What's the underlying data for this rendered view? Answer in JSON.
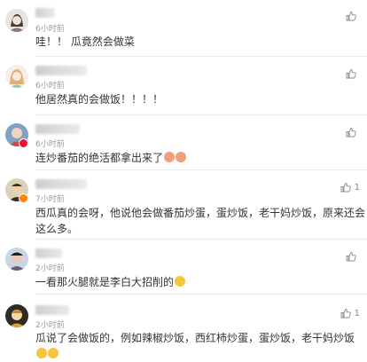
{
  "comments": [
    {
      "time": "6小时前",
      "text": "哇！！ 瓜竟然会做菜",
      "likes": "",
      "avatar": "anime-girl-avatar"
    },
    {
      "time": "6小时前",
      "text": "他居然真的会做饭！！！！",
      "likes": "",
      "avatar": "anime-girl-avatar"
    },
    {
      "time": "6小时前",
      "text": "连炒番茄的绝活都拿出来了",
      "likes": "",
      "avatar": "photo-avatar"
    },
    {
      "time": "7小时前",
      "text": "西瓜真的会呀，他说他会做番茄炒蛋，蛋炒饭，老干妈炒饭，原来还会这么多。",
      "likes": "1",
      "avatar": "photo-avatar"
    },
    {
      "time": "2小时前",
      "text": "一看那火腿就是李白大招削的",
      "likes": "",
      "avatar": "photo-avatar"
    },
    {
      "time": "2小时前",
      "text": "瓜说了会做饭的，例如辣椒炒饭，西红柿炒蛋，蛋炒饭，老干妈炒饭",
      "likes": "1",
      "avatar": "photo-avatar"
    }
  ],
  "icons": {
    "like": "thumbs-up-icon"
  },
  "colors": {
    "text": "#333333",
    "meta": "#9a9a9a",
    "divider": "#ececec"
  }
}
